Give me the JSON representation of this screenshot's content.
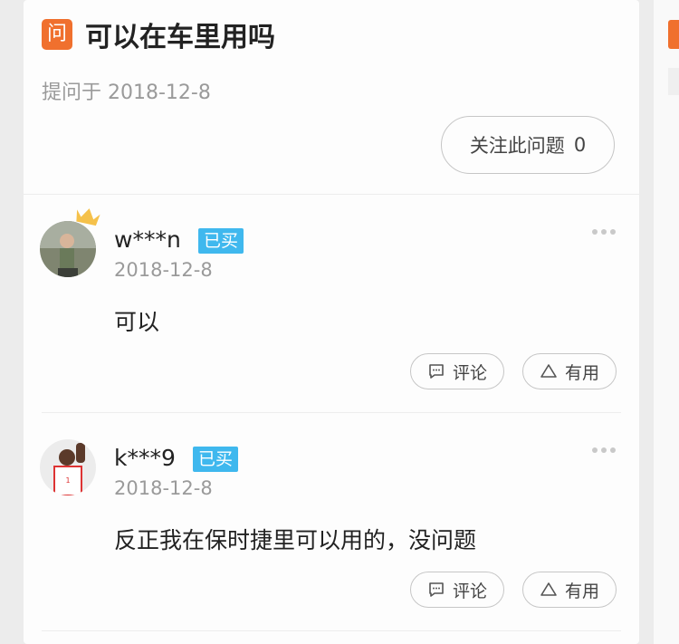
{
  "question": {
    "badge": "问",
    "title": "可以在车里用吗",
    "date": "提问于 2018-12-8",
    "follow_label": "关注此问题",
    "follow_count": "0"
  },
  "answers": [
    {
      "username": "w***n",
      "badge": "已买",
      "date": "2018-12-8",
      "content": "可以",
      "comment_label": "评论",
      "useful_label": "有用"
    },
    {
      "username": "k***9",
      "badge": "已买",
      "date": "2018-12-8",
      "content": "反正我在保时捷里可以用的，没问题",
      "comment_label": "评论",
      "useful_label": "有用"
    }
  ],
  "colors": {
    "accent": "#f0702e",
    "buy_badge": "#3fb8ee",
    "muted_text": "#9a9a9a"
  }
}
